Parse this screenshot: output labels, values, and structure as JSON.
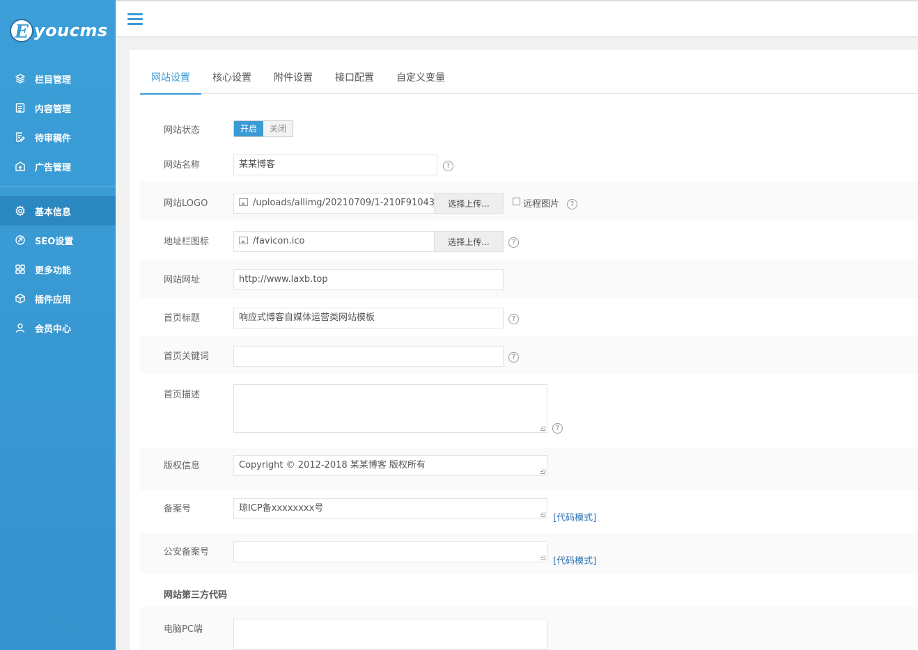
{
  "brand": {
    "logo_letter": "E",
    "logo_text": "youcms"
  },
  "sidebar": {
    "items": [
      {
        "label": "栏目管理",
        "icon": "layers-icon"
      },
      {
        "label": "内容管理",
        "icon": "document-icon"
      },
      {
        "label": "待审稿件",
        "icon": "edit-document-icon"
      },
      {
        "label": "广告管理",
        "icon": "ad-icon"
      },
      {
        "label": "基本信息",
        "icon": "gear-icon",
        "active": true
      },
      {
        "label": "SEO设置",
        "icon": "seo-icon"
      },
      {
        "label": "更多功能",
        "icon": "grid-icon"
      },
      {
        "label": "插件应用",
        "icon": "box-icon"
      },
      {
        "label": "会员中心",
        "icon": "user-icon"
      }
    ]
  },
  "tabs": [
    {
      "label": "网站设置",
      "active": true
    },
    {
      "label": "核心设置"
    },
    {
      "label": "附件设置"
    },
    {
      "label": "接口配置"
    },
    {
      "label": "自定义变量"
    }
  ],
  "form": {
    "status": {
      "label": "网站状态",
      "on": "开启",
      "off": "关闭"
    },
    "name": {
      "label": "网站名称",
      "value": "某某博客"
    },
    "logo": {
      "label": "网站LOGO",
      "value": "/uploads/allimg/20210709/1-210F91043",
      "button": "选择上传...",
      "remote_label": "远程图片"
    },
    "favicon": {
      "label": "地址栏图标",
      "value": "/favicon.ico",
      "button": "选择上传..."
    },
    "url": {
      "label": "网站网址",
      "value": "http://www.laxb.top"
    },
    "title": {
      "label": "首页标题",
      "value": "响应式博客自媒体运营类网站模板"
    },
    "keywords": {
      "label": "首页关键词",
      "value": ""
    },
    "description": {
      "label": "首页描述",
      "value": ""
    },
    "copyright": {
      "label": "版权信息",
      "value": "Copyright © 2012-2018 某某博客 版权所有"
    },
    "icp": {
      "label": "备案号",
      "value": "琼ICP备xxxxxxxx号",
      "link": "[代码模式]"
    },
    "police": {
      "label": "公安备案号",
      "value": "",
      "link": "[代码模式]"
    },
    "third_party": {
      "heading": "网站第三方代码"
    },
    "pc": {
      "label": "电脑PC端",
      "value": ""
    }
  },
  "help_glyph": "?",
  "colors": {
    "accent": "#3a9bd5",
    "sidebar": "#3a9bd5",
    "link": "#2a6fb0"
  }
}
